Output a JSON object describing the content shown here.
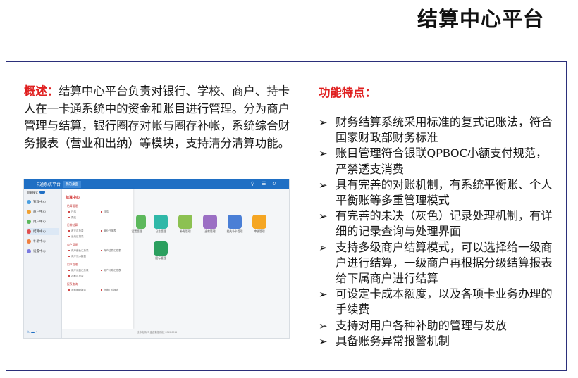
{
  "slide_title": "结算中心平台",
  "overview": {
    "lead": "概述：",
    "body": "结算中心平台负责对银行、学校、商户、持卡人在一卡通系统中的资金和账目进行管理。分为商户管理与结算，银行圈存对帐与圈存补帐，系统综合财务报表（营业和出纳）等模块，支持清分清算功能。"
  },
  "features": {
    "heading": "功能特点：",
    "bullet_glyph": "➢",
    "items": [
      "财务结算系统采用标准的复式记账法，符合国家财政部财务标准",
      "账目管理符合银联QPBOC小额支付规范，严禁透支消费",
      "具有完善的对账机制，有系统平衡账、个人平衡账等多重管理模式",
      "有完善的未决（灰色）记录处理机制，有详细的记录查询与处理界面",
      "支持多级商户结算模式，可以选择给一级商户进行结算，一级商户再根据分级结算报表给下属商户进行结算",
      "可设定卡成本额度，以及各项卡业务办理的手续费",
      "支持对用户各种补助的管理与发放",
      "具备账务异常报警机制"
    ]
  },
  "screenshot": {
    "brand": "一卡通系统平台",
    "tab": "我的桌面",
    "status_label": "电脑模式",
    "sidebar": [
      {
        "label": "管理中心",
        "color": "#4a9fe0"
      },
      {
        "label": "商户中心",
        "color": "#f0a030"
      },
      {
        "label": "用户中心",
        "color": "#5cb85c"
      },
      {
        "label": "结算中心",
        "color": "#e05050"
      },
      {
        "label": "补助中心",
        "color": "#f08040"
      },
      {
        "label": "设置中心",
        "color": "#7a7ae0"
      }
    ],
    "panel_title": "结算中心",
    "panel_sections": [
      "结算管理",
      "日常结算",
      "商户管理",
      "用户管理",
      "报表查询"
    ],
    "panel_links": [
      "日结",
      "月结",
      "周结",
      "收支汇总表",
      "营业日报表",
      "出纳日报表",
      "商户营业汇总表",
      "商户结算汇总表",
      "商户流水报表",
      "用户消费汇总表",
      "用户补助汇总表",
      "补助汇总表",
      "消费明细报表",
      "充值汇总报表"
    ],
    "tiles": [
      {
        "label": "日志管理",
        "color": "#2fb8a8"
      },
      {
        "label": "补贴管理",
        "color": "#8cc152"
      },
      {
        "label": "退款管理",
        "color": "#9b6fc4"
      },
      {
        "label": "挂失补卡管理",
        "color": "#4a7fd6"
      },
      {
        "label": "审核管理",
        "color": "#f5a623"
      },
      {
        "label": "设置管理",
        "color": "#5cb85c"
      },
      {
        "label": "图标管理",
        "color": "#2b9f5f"
      }
    ],
    "copyright": "技术支持 © 金鑫数据科技 2015-2016"
  }
}
